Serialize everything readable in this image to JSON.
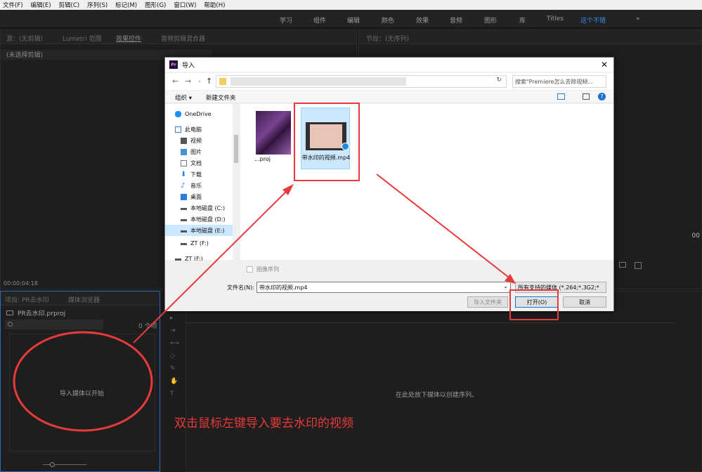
{
  "menu": [
    "文件(F)",
    "编辑(E)",
    "剪辑(C)",
    "序列(S)",
    "标记(M)",
    "图形(G)",
    "窗口(W)",
    "帮助(H)"
  ],
  "workspaces": [
    "学习",
    "组件",
    "编辑",
    "颜色",
    "效果",
    "音频",
    "图形",
    "库",
    "Titles",
    "这个不错",
    "»"
  ],
  "source_panel": {
    "tabs": [
      "源：(无剪辑)",
      "Lumetri 范围",
      "效果控件",
      "音频剪辑混合器"
    ],
    "no_clip": "(未选择剪辑)",
    "timecode": "00:00:04:18"
  },
  "program_panel": {
    "tab": "节目：(无序列)",
    "timecode": "00"
  },
  "project_panel": {
    "tabs": [
      "项目: PR去水印",
      "媒体浏览器"
    ],
    "project_file": "PR去水印.prproj",
    "item_count": "0 个项",
    "empty_text": "导入媒体以开始"
  },
  "timeline": {
    "empty_text": "在此处放下媒体以创建序列。"
  },
  "dialog": {
    "title": "导入",
    "search_placeholder": "搜索\"Premiere怎么去除视频...",
    "organize": "组织 ▾",
    "new_folder": "新建文件夹",
    "nav_items": [
      "OneDrive",
      "此电脑",
      "视频",
      "图片",
      "文档",
      "下载",
      "音乐",
      "桌面",
      "本地磁盘 (C:)",
      "本地磁盘 (D:)",
      "本地磁盘 (E:)",
      "ZT (F:)",
      "ZT (F:)"
    ],
    "file1": "...proj",
    "file2": "带水印的视频.mp4",
    "image_sequence": "图像序列",
    "filename_label": "文件名(N):",
    "filename_value": "带水印的视频.mp4",
    "filetype": "所有支持的媒体 (*.264;*.3G2;*",
    "import_folder": "导入文件夹",
    "open": "打开(O)",
    "cancel": "取消"
  },
  "annotation": "双击鼠标左键导入要去水印的视频",
  "colors": {
    "accent": "#2d8ceb",
    "annotation": "#e83a3a"
  }
}
